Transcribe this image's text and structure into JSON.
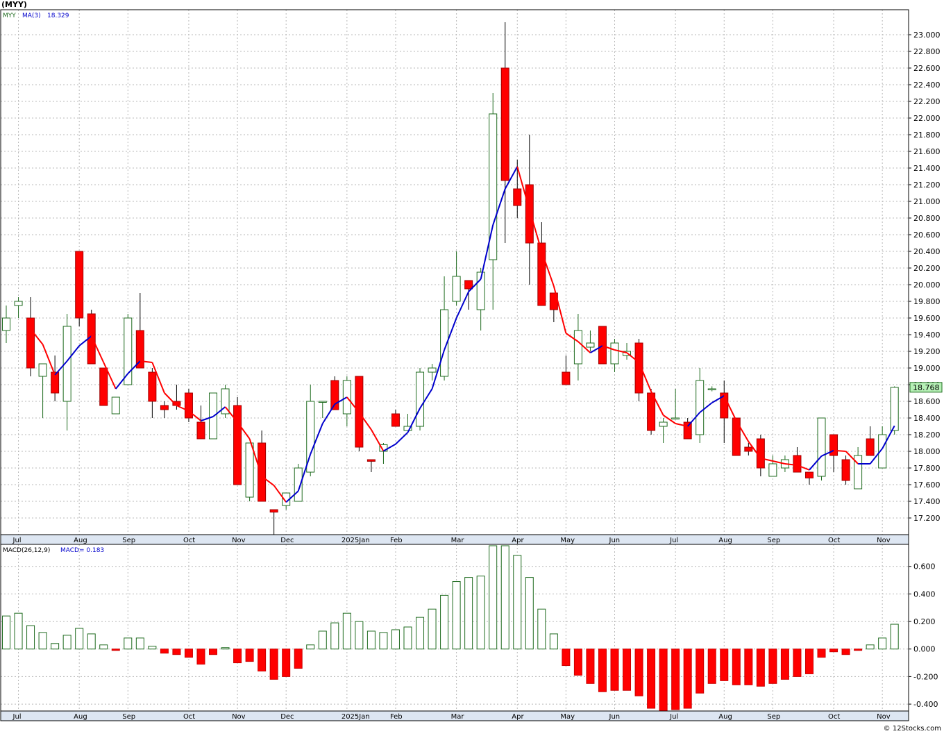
{
  "title": "(MYY)",
  "watermark": "© 12Stocks.com",
  "legend_price": {
    "symbol": "MYY",
    "ma_label": "MA(3)",
    "ma_value": "18.329"
  },
  "legend_macd": {
    "label": "MACD(26,12,9)",
    "value_label": "MACD= 0.183"
  },
  "last_price_label": "18.768",
  "colors": {
    "up": "#1f6b1f",
    "down": "#ff0000",
    "ma_up": "#0000cc",
    "ma_down": "#ff0000",
    "axis_band": "#dde6f2",
    "last_price_bg": "#b6f0b6"
  },
  "chart_data": [
    {
      "type": "candlestick",
      "title": "(MYY)",
      "ylim": [
        17.0,
        23.3
      ],
      "y_ticks": [
        "17.200",
        "17.400",
        "17.600",
        "17.800",
        "18.000",
        "18.200",
        "18.400",
        "18.600",
        "18.800",
        "19.000",
        "19.200",
        "19.400",
        "19.600",
        "19.800",
        "20.000",
        "20.200",
        "20.400",
        "20.600",
        "20.800",
        "21.000",
        "21.200",
        "21.400",
        "21.600",
        "21.800",
        "22.000",
        "22.200",
        "22.400",
        "22.600",
        "22.800",
        "23.000"
      ],
      "x_labels": [
        "Jul",
        "Aug",
        "Sep",
        "Oct",
        "Nov",
        "Dec",
        "2025Jan",
        "Feb",
        "Mar",
        "Apr",
        "May",
        "Jun",
        "Jul",
        "Aug",
        "Sep",
        "Oct",
        "Nov"
      ],
      "x_label_index": [
        1,
        6,
        10,
        15,
        19,
        23,
        28,
        32,
        37,
        42,
        46,
        50,
        55,
        59,
        63,
        68,
        72
      ],
      "grid": true,
      "candles": [
        {
          "o": 19.45,
          "h": 19.75,
          "l": 19.3,
          "c": 19.6
        },
        {
          "o": 19.75,
          "h": 19.85,
          "l": 19.6,
          "c": 19.8
        },
        {
          "o": 19.6,
          "h": 19.85,
          "l": 18.9,
          "c": 19.0
        },
        {
          "o": 18.9,
          "h": 19.05,
          "l": 18.4,
          "c": 19.05
        },
        {
          "o": 18.95,
          "h": 19.15,
          "l": 18.6,
          "c": 18.7
        },
        {
          "o": 18.6,
          "h": 19.65,
          "l": 18.25,
          "c": 19.5
        },
        {
          "o": 20.4,
          "h": 20.4,
          "l": 19.5,
          "c": 19.6
        },
        {
          "o": 19.65,
          "h": 19.7,
          "l": 19.05,
          "c": 19.05
        },
        {
          "o": 19.0,
          "h": 19.0,
          "l": 18.55,
          "c": 18.55
        },
        {
          "o": 18.45,
          "h": 18.65,
          "l": 18.45,
          "c": 18.65
        },
        {
          "o": 18.8,
          "h": 19.65,
          "l": 18.8,
          "c": 19.6
        },
        {
          "o": 19.45,
          "h": 19.9,
          "l": 19.0,
          "c": 19.0
        },
        {
          "o": 18.95,
          "h": 19.0,
          "l": 18.4,
          "c": 18.6
        },
        {
          "o": 18.55,
          "h": 18.6,
          "l": 18.4,
          "c": 18.5
        },
        {
          "o": 18.6,
          "h": 18.8,
          "l": 18.5,
          "c": 18.55
        },
        {
          "o": 18.7,
          "h": 18.75,
          "l": 18.35,
          "c": 18.4
        },
        {
          "o": 18.35,
          "h": 18.55,
          "l": 18.15,
          "c": 18.15
        },
        {
          "o": 18.15,
          "h": 18.7,
          "l": 18.15,
          "c": 18.7
        },
        {
          "o": 18.45,
          "h": 18.8,
          "l": 18.4,
          "c": 18.75
        },
        {
          "o": 18.55,
          "h": 18.65,
          "l": 17.6,
          "c": 17.6
        },
        {
          "o": 17.45,
          "h": 18.1,
          "l": 17.4,
          "c": 18.1
        },
        {
          "o": 18.1,
          "h": 18.25,
          "l": 17.4,
          "c": 17.4
        },
        {
          "o": 17.3,
          "h": 17.3,
          "l": 17.0,
          "c": 17.27
        },
        {
          "o": 17.35,
          "h": 17.5,
          "l": 17.3,
          "c": 17.5
        },
        {
          "o": 17.4,
          "h": 17.85,
          "l": 17.4,
          "c": 17.8
        },
        {
          "o": 17.75,
          "h": 18.8,
          "l": 17.7,
          "c": 18.6
        },
        {
          "o": 18.6,
          "h": 18.6,
          "l": 18.4,
          "c": 18.6
        },
        {
          "o": 18.85,
          "h": 18.9,
          "l": 18.5,
          "c": 18.5
        },
        {
          "o": 18.45,
          "h": 18.9,
          "l": 18.3,
          "c": 18.85
        },
        {
          "o": 18.9,
          "h": 18.9,
          "l": 18.0,
          "c": 18.05
        },
        {
          "o": 17.9,
          "h": 17.9,
          "l": 17.75,
          "c": 17.88
        },
        {
          "o": 18.0,
          "h": 18.1,
          "l": 17.85,
          "c": 18.08
        },
        {
          "o": 18.45,
          "h": 18.5,
          "l": 18.3,
          "c": 18.3
        },
        {
          "o": 18.25,
          "h": 18.45,
          "l": 18.25,
          "c": 18.3
        },
        {
          "o": 18.3,
          "h": 19.0,
          "l": 18.25,
          "c": 18.95
        },
        {
          "o": 18.95,
          "h": 19.05,
          "l": 18.85,
          "c": 19.0
        },
        {
          "o": 18.9,
          "h": 20.1,
          "l": 18.85,
          "c": 19.7
        },
        {
          "o": 19.8,
          "h": 20.4,
          "l": 19.75,
          "c": 20.1
        },
        {
          "o": 20.05,
          "h": 20.05,
          "l": 19.7,
          "c": 19.95
        },
        {
          "o": 19.7,
          "h": 20.2,
          "l": 19.45,
          "c": 20.15
        },
        {
          "o": 20.3,
          "h": 22.3,
          "l": 19.7,
          "c": 22.05
        },
        {
          "o": 22.6,
          "h": 23.15,
          "l": 20.5,
          "c": 21.25
        },
        {
          "o": 21.15,
          "h": 21.5,
          "l": 20.8,
          "c": 20.95
        },
        {
          "o": 21.2,
          "h": 21.8,
          "l": 20.0,
          "c": 20.5
        },
        {
          "o": 20.5,
          "h": 20.75,
          "l": 19.75,
          "c": 19.75
        },
        {
          "o": 19.9,
          "h": 19.9,
          "l": 19.55,
          "c": 19.7
        },
        {
          "o": 18.95,
          "h": 19.15,
          "l": 18.8,
          "c": 18.8
        },
        {
          "o": 19.05,
          "h": 19.65,
          "l": 18.85,
          "c": 19.45
        },
        {
          "o": 19.25,
          "h": 19.45,
          "l": 19.2,
          "c": 19.3
        },
        {
          "o": 19.5,
          "h": 19.5,
          "l": 19.05,
          "c": 19.05
        },
        {
          "o": 19.05,
          "h": 19.35,
          "l": 18.95,
          "c": 19.3
        },
        {
          "o": 19.15,
          "h": 19.3,
          "l": 19.1,
          "c": 19.2
        },
        {
          "o": 19.3,
          "h": 19.35,
          "l": 18.6,
          "c": 18.7
        },
        {
          "o": 18.7,
          "h": 18.75,
          "l": 18.2,
          "c": 18.25
        },
        {
          "o": 18.3,
          "h": 18.4,
          "l": 18.1,
          "c": 18.35
        },
        {
          "o": 18.4,
          "h": 18.75,
          "l": 18.4,
          "c": 18.4
        },
        {
          "o": 18.35,
          "h": 18.4,
          "l": 18.15,
          "c": 18.15
        },
        {
          "o": 18.2,
          "h": 19.0,
          "l": 18.1,
          "c": 18.85
        },
        {
          "o": 18.75,
          "h": 18.78,
          "l": 18.72,
          "c": 18.75
        },
        {
          "o": 18.7,
          "h": 18.85,
          "l": 18.1,
          "c": 18.4
        },
        {
          "o": 18.4,
          "h": 18.4,
          "l": 17.95,
          "c": 17.95
        },
        {
          "o": 18.05,
          "h": 18.1,
          "l": 17.95,
          "c": 18.0
        },
        {
          "o": 18.15,
          "h": 18.2,
          "l": 17.7,
          "c": 17.8
        },
        {
          "o": 17.7,
          "h": 17.95,
          "l": 17.7,
          "c": 17.85
        },
        {
          "o": 17.8,
          "h": 17.95,
          "l": 17.75,
          "c": 17.9
        },
        {
          "o": 17.95,
          "h": 18.05,
          "l": 17.75,
          "c": 17.75
        },
        {
          "o": 17.75,
          "h": 17.75,
          "l": 17.6,
          "c": 17.68
        },
        {
          "o": 17.7,
          "h": 18.4,
          "l": 17.65,
          "c": 18.4
        },
        {
          "o": 18.2,
          "h": 18.2,
          "l": 17.75,
          "c": 17.95
        },
        {
          "o": 17.9,
          "h": 17.95,
          "l": 17.6,
          "c": 17.65
        },
        {
          "o": 17.55,
          "h": 18.05,
          "l": 17.55,
          "c": 17.95
        },
        {
          "o": 18.15,
          "h": 18.3,
          "l": 17.95,
          "c": 17.95
        },
        {
          "o": 17.8,
          "h": 18.3,
          "l": 17.8,
          "c": 18.2
        },
        {
          "o": 18.25,
          "h": 18.78,
          "l": 18.2,
          "c": 18.768
        }
      ]
    },
    {
      "type": "bar",
      "title": "MACD(26,12,9)",
      "ylim": [
        -0.45,
        0.76
      ],
      "y_ticks": [
        "-0.400",
        "-0.200",
        "0.000",
        "0.200",
        "0.400",
        "0.600"
      ],
      "x_labels": [
        "Jul",
        "Aug",
        "Sep",
        "Oct",
        "Nov",
        "Dec",
        "2025Jan",
        "Feb",
        "Mar",
        "Apr",
        "May",
        "Jun",
        "Jul",
        "Aug",
        "Sep",
        "Oct",
        "Nov"
      ],
      "values": [
        0.24,
        0.26,
        0.17,
        0.12,
        0.04,
        0.1,
        0.15,
        0.11,
        0.03,
        -0.01,
        0.08,
        0.08,
        0.02,
        -0.03,
        -0.04,
        -0.06,
        -0.11,
        -0.04,
        0.01,
        -0.1,
        -0.09,
        -0.16,
        -0.22,
        -0.2,
        -0.14,
        0.03,
        0.13,
        0.19,
        0.26,
        0.2,
        0.13,
        0.12,
        0.14,
        0.16,
        0.23,
        0.29,
        0.39,
        0.49,
        0.52,
        0.53,
        0.75,
        0.75,
        0.68,
        0.52,
        0.29,
        0.11,
        -0.12,
        -0.19,
        -0.25,
        -0.31,
        -0.3,
        -0.3,
        -0.34,
        -0.43,
        -0.46,
        -0.44,
        -0.43,
        -0.32,
        -0.25,
        -0.23,
        -0.26,
        -0.26,
        -0.27,
        -0.25,
        -0.22,
        -0.2,
        -0.18,
        -0.06,
        -0.02,
        -0.04,
        -0.01,
        0.03,
        0.08,
        0.18
      ]
    }
  ]
}
